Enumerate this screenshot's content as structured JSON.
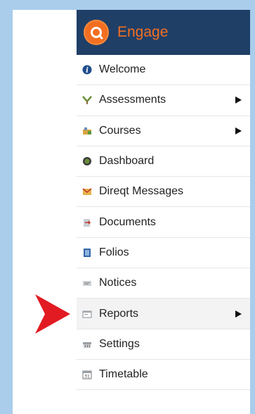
{
  "brand": {
    "title": "Engage",
    "logo_icon": "q-logo-icon",
    "color": "#f26f21"
  },
  "header": {
    "background": "#1f3f67"
  },
  "menu": {
    "items": [
      {
        "label": "Welcome",
        "icon": "info-icon",
        "submenu": false
      },
      {
        "label": "Assessments",
        "icon": "assessment-icon",
        "submenu": true
      },
      {
        "label": "Courses",
        "icon": "courses-icon",
        "submenu": true
      },
      {
        "label": "Dashboard",
        "icon": "dashboard-icon",
        "submenu": false
      },
      {
        "label": "Direqt Messages",
        "icon": "messages-icon",
        "submenu": false
      },
      {
        "label": "Documents",
        "icon": "documents-icon",
        "submenu": false
      },
      {
        "label": "Folios",
        "icon": "folios-icon",
        "submenu": false
      },
      {
        "label": "Notices",
        "icon": "notices-icon",
        "submenu": false
      },
      {
        "label": "Reports",
        "icon": "reports-icon",
        "submenu": true,
        "highlighted": true
      },
      {
        "label": "Settings",
        "icon": "settings-icon",
        "submenu": false
      },
      {
        "label": "Timetable",
        "icon": "timetable-icon",
        "submenu": false
      }
    ]
  },
  "annotation": {
    "icon": "red-arrow-pointer-icon",
    "color": "#e21b23"
  }
}
